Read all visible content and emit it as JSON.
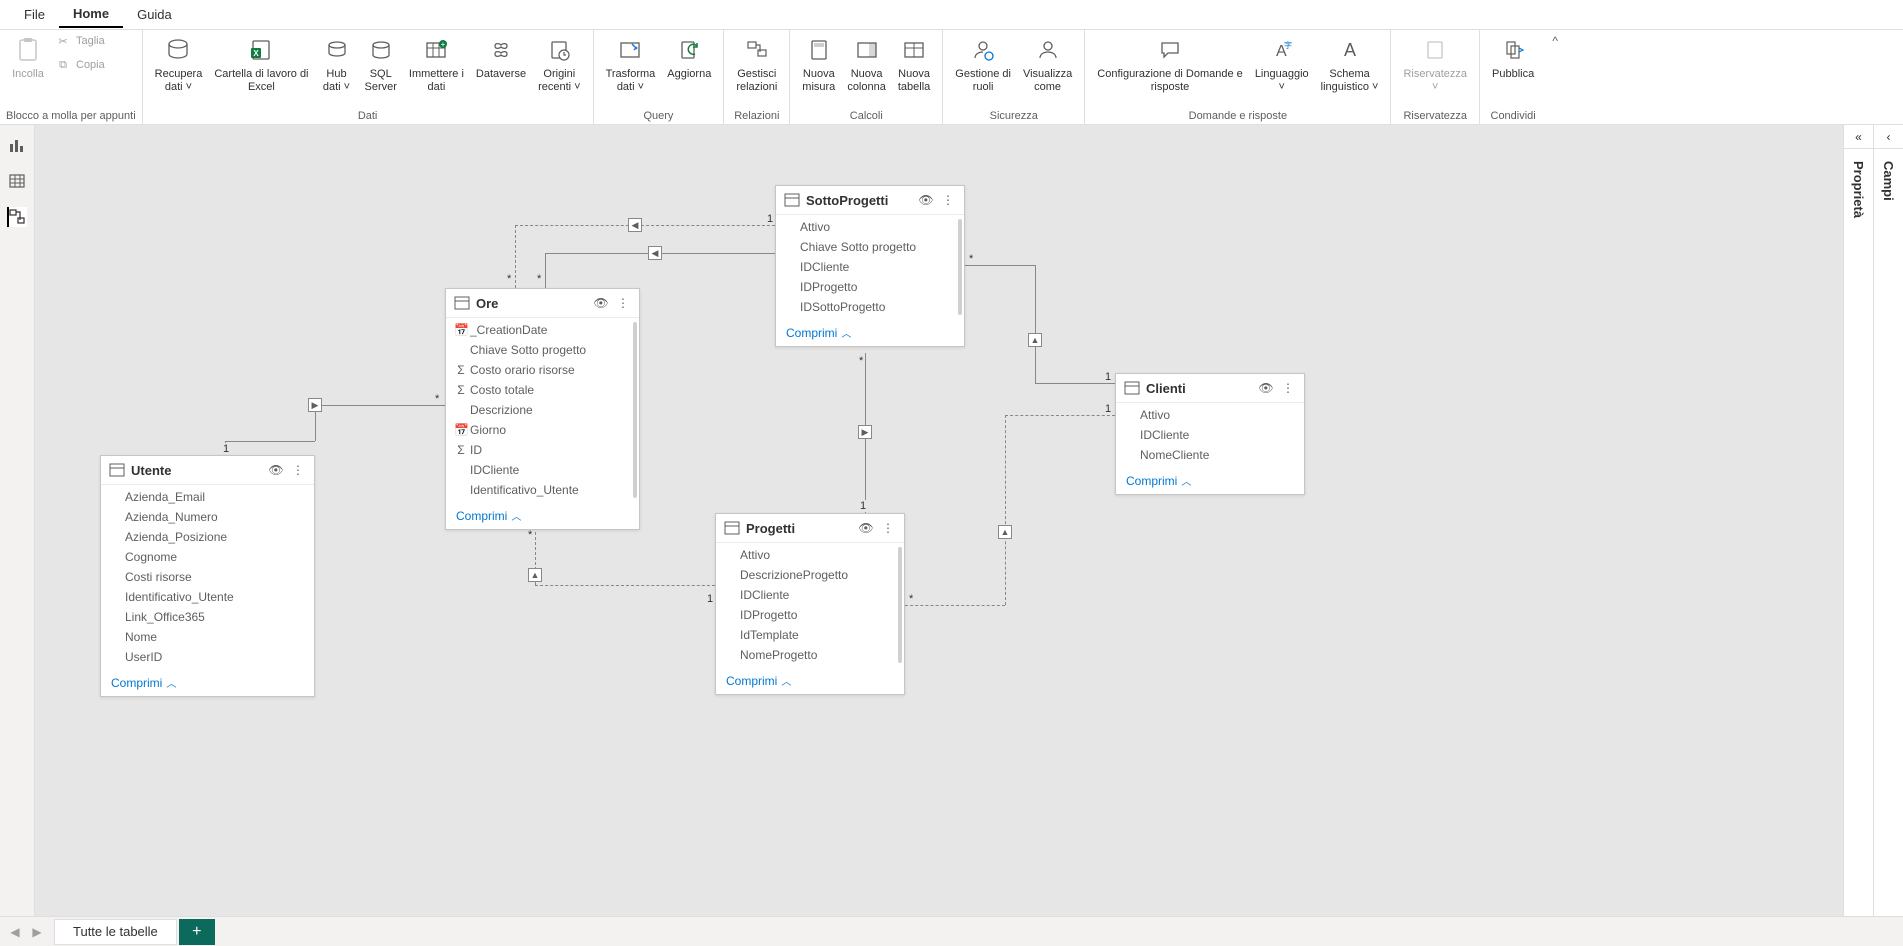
{
  "tabs": {
    "file": "File",
    "home": "Home",
    "guide": "Guida"
  },
  "ribbon": {
    "clipboard": {
      "paste": "Incolla",
      "cut": "Taglia",
      "copy": "Copia",
      "group": "Blocco a molla per appunti"
    },
    "data": {
      "get_data": "Recupera\ndati ˅",
      "excel": "Cartella di lavoro di\nExcel",
      "hub": "Hub\ndati ˅",
      "sql": "SQL\nServer",
      "enter": "Immettere i\ndati",
      "dataverse": "Dataverse",
      "recent": "Origini\nrecenti ˅",
      "group": "Dati"
    },
    "query": {
      "transform": "Trasforma\ndati ˅",
      "refresh": "Aggiorna",
      "group": "Query"
    },
    "relations": {
      "manage": "Gestisci\nrelazioni",
      "group": "Relazioni"
    },
    "calc": {
      "measure": "Nuova\nmisura",
      "column": "Nuova\ncolonna",
      "table": "Nuova\ntabella",
      "group": "Calcoli"
    },
    "security": {
      "roles": "Gestione di\nruoli",
      "view_as": "Visualizza\ncome",
      "group": "Sicurezza"
    },
    "qa": {
      "config": "Configurazione di Domande e\nrisposte",
      "lang": "Linguaggio\n˅",
      "schema": "Schema\nlinguistico ˅",
      "group": "Domande e risposte"
    },
    "sens": {
      "label": "Riservatezza\n˅",
      "group": "Riservatezza"
    },
    "share": {
      "publish": "Pubblica",
      "group": "Condividi"
    }
  },
  "panes": {
    "properties": "Proprietà",
    "fields": "Campi"
  },
  "entities": {
    "utente": {
      "title": "Utente",
      "fields": [
        "Azienda_Email",
        "Azienda_Numero",
        "Azienda_Posizione",
        "Cognome",
        "Costi risorse",
        "Identificativo_Utente",
        "Link_Office365",
        "Nome",
        "UserID"
      ],
      "collapse": "Comprimi"
    },
    "ore": {
      "title": "Ore",
      "fields": [
        {
          "icon": "date",
          "name": "_CreationDate"
        },
        {
          "icon": "",
          "name": "Chiave Sotto progetto"
        },
        {
          "icon": "sum",
          "name": "Costo orario risorse"
        },
        {
          "icon": "sum",
          "name": "Costo totale"
        },
        {
          "icon": "",
          "name": "Descrizione"
        },
        {
          "icon": "date",
          "name": "Giorno"
        },
        {
          "icon": "sum",
          "name": "ID"
        },
        {
          "icon": "",
          "name": "IDCliente"
        },
        {
          "icon": "",
          "name": "Identificativo_Utente"
        }
      ],
      "collapse": "Comprimi"
    },
    "sottoprogetti": {
      "title": "SottoProgetti",
      "fields": [
        "Attivo",
        "Chiave Sotto progetto",
        "IDCliente",
        "IDProgetto",
        "IDSottoProgetto"
      ],
      "collapse": "Comprimi"
    },
    "clienti": {
      "title": "Clienti",
      "fields": [
        "Attivo",
        "IDCliente",
        "NomeCliente"
      ],
      "collapse": "Comprimi"
    },
    "progetti": {
      "title": "Progetti",
      "fields": [
        "Attivo",
        "DescrizioneProgetto",
        "IDCliente",
        "IDProgetto",
        "IdTemplate",
        "NomeProgetto"
      ],
      "collapse": "Comprimi"
    }
  },
  "rel_markers": {
    "one": "1",
    "many": "*"
  },
  "bottom": {
    "all_tables": "Tutte le tabelle"
  }
}
